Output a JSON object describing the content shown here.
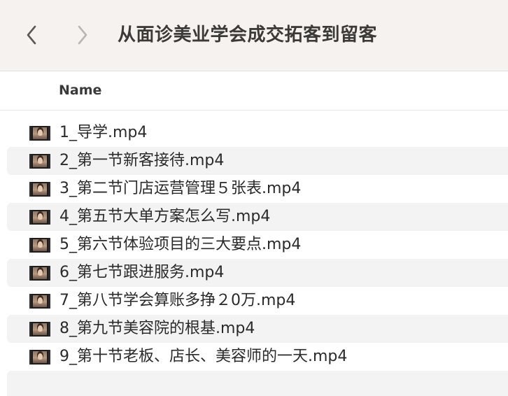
{
  "toolbar": {
    "title": "从面诊美业学会成交拓客到留客",
    "back_icon": "chevron-left-icon",
    "forward_icon": "chevron-right-icon"
  },
  "columns": {
    "name": "Name"
  },
  "files": [
    {
      "name": "1_导学.mp4",
      "icon": "video-thumbnail-icon"
    },
    {
      "name": "2_第一节新客接待.mp4",
      "icon": "video-thumbnail-icon"
    },
    {
      "name": "3_第二节门店运营管理５张表.mp4",
      "icon": "video-thumbnail-icon"
    },
    {
      "name": "4_第五节大单方案怎么写.mp4",
      "icon": "video-thumbnail-icon"
    },
    {
      "name": "5_第六节体验项目的三大要点.mp4",
      "icon": "video-thumbnail-icon"
    },
    {
      "name": "6_第七节跟进服务.mp4",
      "icon": "video-thumbnail-icon"
    },
    {
      "name": "7_第八节学会算账多挣２0万.mp4",
      "icon": "video-thumbnail-icon"
    },
    {
      "name": "8_第九节美容院的根基.mp4",
      "icon": "video-thumbnail-icon"
    },
    {
      "name": "9_第十节老板、店长、美容师的一天.mp4",
      "icon": "video-thumbnail-icon"
    }
  ]
}
